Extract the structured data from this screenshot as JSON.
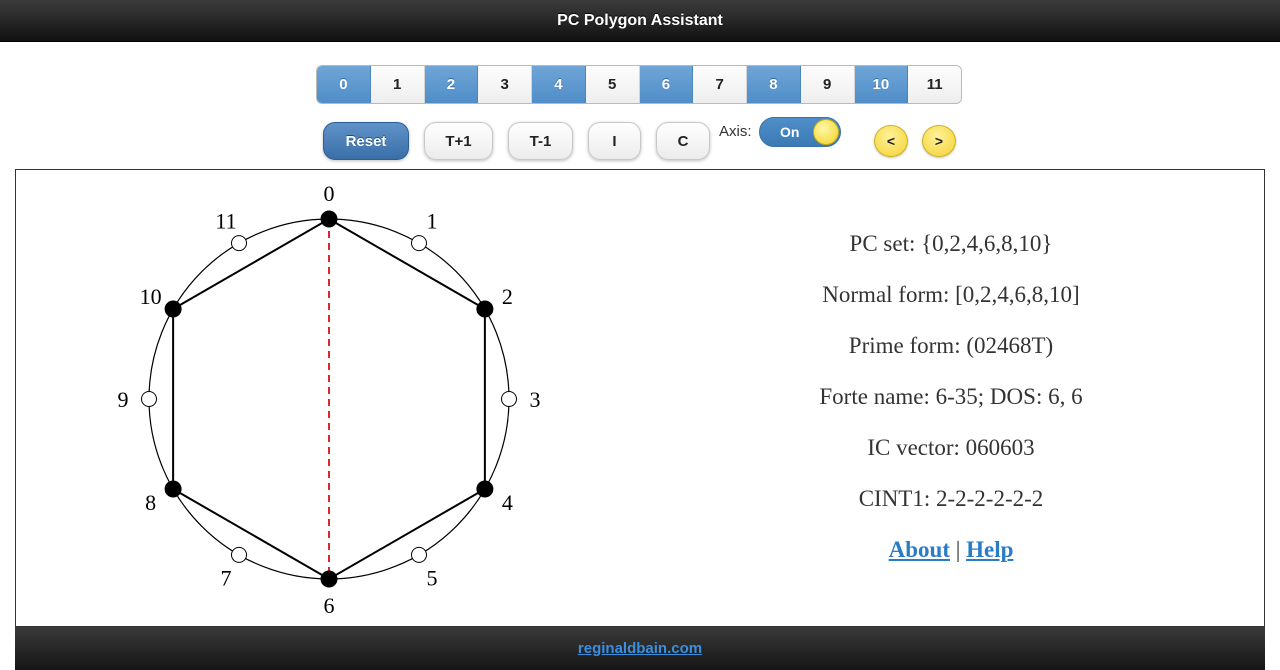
{
  "header": {
    "title": "PC Polygon Assistant"
  },
  "pc_buttons": [
    {
      "label": "0",
      "on": true
    },
    {
      "label": "1",
      "on": false
    },
    {
      "label": "2",
      "on": true
    },
    {
      "label": "3",
      "on": false
    },
    {
      "label": "4",
      "on": true
    },
    {
      "label": "5",
      "on": false
    },
    {
      "label": "6",
      "on": true
    },
    {
      "label": "7",
      "on": false
    },
    {
      "label": "8",
      "on": true
    },
    {
      "label": "9",
      "on": false
    },
    {
      "label": "10",
      "on": true
    },
    {
      "label": "11",
      "on": false
    }
  ],
  "toolbar": {
    "reset_label": "Reset",
    "t_plus_label": "T+1",
    "t_minus_label": "T-1",
    "i_label": "I",
    "c_label": "C",
    "axis_label": "Axis:",
    "axis_state": "On",
    "prev_label": "<",
    "next_label": ">"
  },
  "colors": {
    "selected": "#4f8ec8",
    "axis_line": "#e0262a",
    "link": "#2a7cc7",
    "knob": "#f2d321"
  },
  "clock": {
    "labels": [
      "0",
      "1",
      "2",
      "3",
      "4",
      "5",
      "6",
      "7",
      "8",
      "9",
      "10",
      "11"
    ],
    "selected": [
      0,
      2,
      4,
      6,
      8,
      10
    ],
    "axis": [
      0,
      6
    ]
  },
  "info": {
    "pc_set": "PC set: {0,2,4,6,8,10}",
    "normal_form": "Normal form: [0,2,4,6,8,10]",
    "prime_form": "Prime form: (02468T)",
    "forte": "Forte name: 6-35; DOS: 6, 6",
    "ic_vector": "IC vector: 060603",
    "cint": "CINT1: 2-2-2-2-2-2",
    "about_label": "About",
    "separator": "|",
    "help_label": "Help"
  },
  "footer": {
    "link_label": "reginaldbain.com"
  }
}
